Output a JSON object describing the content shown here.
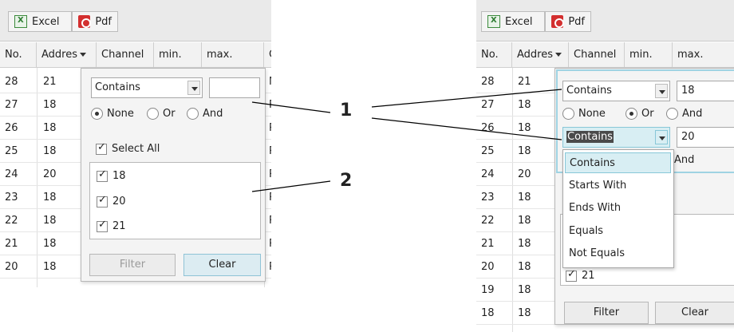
{
  "toolbar": {
    "excel_label": "Excel",
    "pdf_label": "Pdf"
  },
  "left": {
    "headers": [
      "No.",
      "Addres",
      "Channel",
      "min.",
      "max.",
      "C"
    ],
    "rows": [
      {
        "no": "28",
        "addr": "21",
        "c": "N"
      },
      {
        "no": "27",
        "addr": "18",
        "c": "R"
      },
      {
        "no": "26",
        "addr": "18",
        "c": "R"
      },
      {
        "no": "25",
        "addr": "18",
        "c": "R"
      },
      {
        "no": "24",
        "addr": "20",
        "c": "R"
      },
      {
        "no": "23",
        "addr": "18",
        "c": "R"
      },
      {
        "no": "22",
        "addr": "18",
        "c": "R"
      },
      {
        "no": "21",
        "addr": "18",
        "c": "R"
      },
      {
        "no": "20",
        "addr": "18",
        "c": "R"
      }
    ],
    "filter": {
      "operator": "Contains",
      "value": "",
      "radios": [
        "None",
        "Or",
        "And"
      ],
      "selected_radio": "None",
      "select_all": "Select All",
      "items": [
        "18",
        "20",
        "21"
      ],
      "filter_btn": "Filter",
      "clear_btn": "Clear"
    }
  },
  "right": {
    "headers": [
      "No.",
      "Addres",
      "Channel",
      "min.",
      "max."
    ],
    "rows": [
      {
        "no": "28",
        "addr": "21"
      },
      {
        "no": "27",
        "addr": "18"
      },
      {
        "no": "26",
        "addr": "18"
      },
      {
        "no": "25",
        "addr": "18"
      },
      {
        "no": "24",
        "addr": "20"
      },
      {
        "no": "23",
        "addr": "18"
      },
      {
        "no": "22",
        "addr": "18"
      },
      {
        "no": "21",
        "addr": "18"
      },
      {
        "no": "20",
        "addr": "18"
      },
      {
        "no": "19",
        "addr": "18"
      },
      {
        "no": "18",
        "addr": "18"
      }
    ],
    "filter": {
      "operator1": "Contains",
      "value1": "18",
      "radios": [
        "None",
        "Or",
        "And"
      ],
      "selected_radio": "Or",
      "operator2": "Contains",
      "value2": "20",
      "partial_and": "And",
      "visible_item": "21",
      "menu": [
        "Contains",
        "Starts With",
        "Ends With",
        "Equals",
        "Not Equals"
      ],
      "highlighted": "Contains",
      "filter_btn": "Filter",
      "clear_btn": "Clear"
    }
  },
  "callouts": {
    "one": "1",
    "two": "2"
  },
  "colors": {
    "accent": "#88c7d8",
    "pdf": "#d32f2f",
    "excel": "#2e7d32"
  }
}
